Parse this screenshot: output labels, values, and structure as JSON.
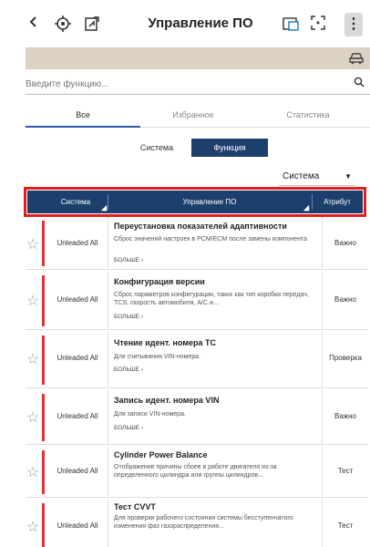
{
  "topbar": {
    "back_icon": "chevron-left-icon",
    "title": "Управление ПО",
    "menu_glyph": "⋮"
  },
  "search": {
    "placeholder": "Введите функцию..."
  },
  "tabs": [
    {
      "label": "Все",
      "active": true
    },
    {
      "label": "Избранное",
      "active": false
    },
    {
      "label": "Статистика",
      "active": false
    }
  ],
  "segments": [
    {
      "label": "Система",
      "active": false
    },
    {
      "label": "Функция",
      "active": true
    }
  ],
  "filter": {
    "selected": "Система"
  },
  "table": {
    "headers": [
      "Система",
      "Управление ПО",
      "Атрибут"
    ],
    "more_label": "БОЛЬШЕ",
    "rows": [
      {
        "system": "Unleaded All",
        "title": "Переустановка показателей адаптивности",
        "desc": "Сброс значений настроек в PCM/ECM после замены компонента",
        "attr": "Важно"
      },
      {
        "system": "Unleaded All",
        "title": "Конфигурация версии",
        "desc": "Сброс параметров конфигурации, таких как тип коробки передач, TCS, скорость автомобиля, A/C и...",
        "attr": "Важно"
      },
      {
        "system": "Unleaded All",
        "title": "Чтение идент. номера ТС",
        "desc": "Для считывания VIN-номера.",
        "attr": "Проверка"
      },
      {
        "system": "Unleaded All",
        "title": "Запись идент. номера VIN",
        "desc": "Для записи VIN-номера.",
        "attr": "Важно"
      },
      {
        "system": "Unleaded All",
        "title": "Cylinder Power Balance",
        "desc": "Отображение причины сбоев в работе двигателя из-за определенного цилиндра или группы цилиндров...",
        "attr": "Тест"
      },
      {
        "system": "Unleaded All",
        "title": "Тест CVVT",
        "desc": "Для проверки рабочего состояния системы бесступенчатого изменения фаз газораспределения...",
        "attr": "Тест"
      }
    ]
  },
  "colors": {
    "accent": "#1c3f6e",
    "highlight_border": "#e41e1e",
    "row_bar": "#d33333",
    "banner": "#dcd2c4"
  }
}
